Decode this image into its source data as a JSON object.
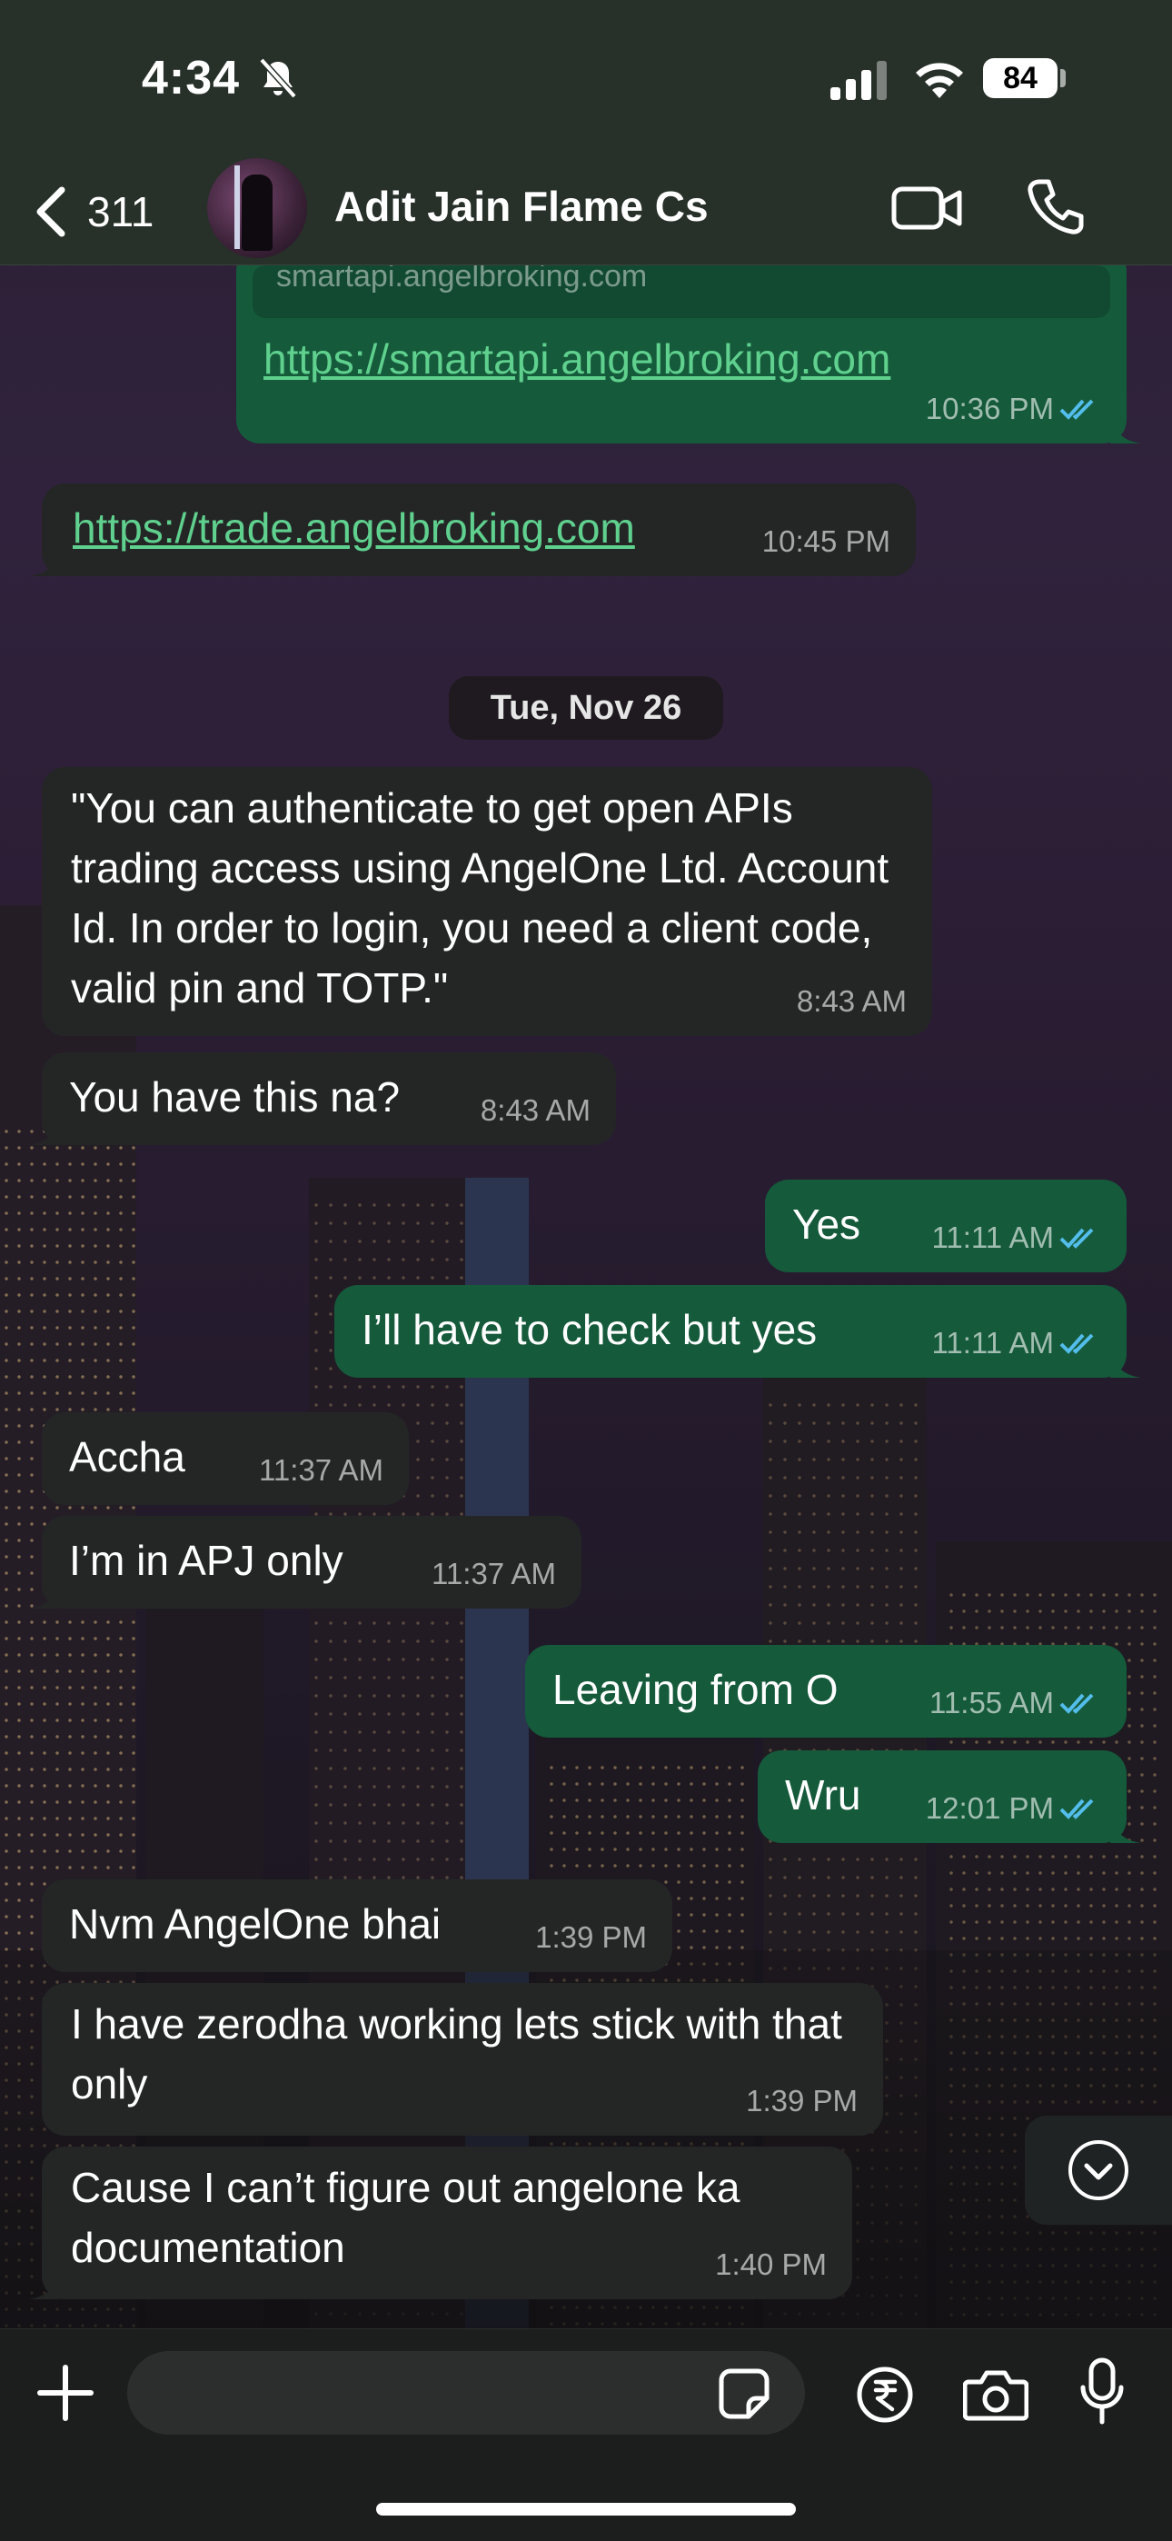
{
  "status_bar": {
    "time": "4:34",
    "battery": "84"
  },
  "header": {
    "back_count": "311",
    "contact_name": "Adit Jain Flame Cs"
  },
  "chat": {
    "link_preview_domain": "smartapi.angelbroking.com",
    "messages": [
      {
        "dir": "out",
        "text": "https://smartapi.angelbroking.com",
        "time": "10:36 PM",
        "link": true
      },
      {
        "dir": "in",
        "text": "https://trade.angelbroking.com",
        "time": "10:45 PM",
        "link": true
      },
      {
        "dir": "in",
        "text": "\"You can authenticate to get open APIs trading access using AngelOne Ltd. Account Id. In order to login, you need a client code, valid pin and TOTP.\"",
        "time": "8:43 AM"
      },
      {
        "dir": "in",
        "text": "You have this na?",
        "time": "8:43 AM"
      },
      {
        "dir": "out",
        "text": "Yes",
        "time": "11:11 AM"
      },
      {
        "dir": "out",
        "text": "I’ll have to check but yes",
        "time": "11:11 AM"
      },
      {
        "dir": "in",
        "text": "Accha",
        "time": "11:37 AM"
      },
      {
        "dir": "in",
        "text": "I’m in APJ only",
        "time": "11:37 AM"
      },
      {
        "dir": "out",
        "text": "Leaving from O",
        "time": "11:55 AM"
      },
      {
        "dir": "out",
        "text": "Wru",
        "time": "12:01 PM"
      },
      {
        "dir": "in",
        "text": "Nvm AngelOne bhai",
        "time": "1:39 PM"
      },
      {
        "dir": "in",
        "text": "I have zerodha working lets stick with that only",
        "time": "1:39 PM"
      },
      {
        "dir": "in",
        "text": "Cause I can’t figure out angelone ka documentation",
        "time": "1:40 PM"
      }
    ],
    "date_separator": "Tue, Nov 26"
  },
  "composer": {
    "placeholder": ""
  },
  "colors": {
    "outgoing_bubble": "#155a3b",
    "incoming_bubble": "#242626",
    "link": "#5fd08e",
    "read_ticks": "#53bdeb"
  },
  "icons": [
    "bell-off-icon",
    "signal-icon",
    "wifi-icon",
    "battery-icon",
    "chevron-left-icon",
    "video-call-icon",
    "phone-icon",
    "chevron-down-icon",
    "plus-icon",
    "sticker-icon",
    "rupee-icon",
    "camera-icon",
    "microphone-icon",
    "double-check-icon"
  ]
}
